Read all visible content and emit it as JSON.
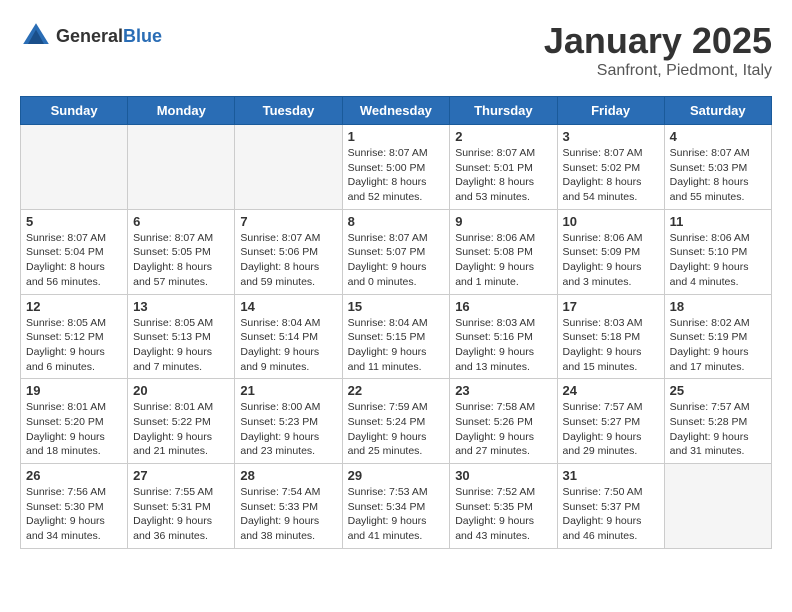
{
  "header": {
    "logo": {
      "text_general": "General",
      "text_blue": "Blue"
    },
    "title": "January 2025",
    "location": "Sanfront, Piedmont, Italy"
  },
  "weekdays": [
    "Sunday",
    "Monday",
    "Tuesday",
    "Wednesday",
    "Thursday",
    "Friday",
    "Saturday"
  ],
  "weeks": [
    [
      {
        "day": "",
        "info": ""
      },
      {
        "day": "",
        "info": ""
      },
      {
        "day": "",
        "info": ""
      },
      {
        "day": "1",
        "info": "Sunrise: 8:07 AM\nSunset: 5:00 PM\nDaylight: 8 hours\nand 52 minutes."
      },
      {
        "day": "2",
        "info": "Sunrise: 8:07 AM\nSunset: 5:01 PM\nDaylight: 8 hours\nand 53 minutes."
      },
      {
        "day": "3",
        "info": "Sunrise: 8:07 AM\nSunset: 5:02 PM\nDaylight: 8 hours\nand 54 minutes."
      },
      {
        "day": "4",
        "info": "Sunrise: 8:07 AM\nSunset: 5:03 PM\nDaylight: 8 hours\nand 55 minutes."
      }
    ],
    [
      {
        "day": "5",
        "info": "Sunrise: 8:07 AM\nSunset: 5:04 PM\nDaylight: 8 hours\nand 56 minutes."
      },
      {
        "day": "6",
        "info": "Sunrise: 8:07 AM\nSunset: 5:05 PM\nDaylight: 8 hours\nand 57 minutes."
      },
      {
        "day": "7",
        "info": "Sunrise: 8:07 AM\nSunset: 5:06 PM\nDaylight: 8 hours\nand 59 minutes."
      },
      {
        "day": "8",
        "info": "Sunrise: 8:07 AM\nSunset: 5:07 PM\nDaylight: 9 hours\nand 0 minutes."
      },
      {
        "day": "9",
        "info": "Sunrise: 8:06 AM\nSunset: 5:08 PM\nDaylight: 9 hours\nand 1 minute."
      },
      {
        "day": "10",
        "info": "Sunrise: 8:06 AM\nSunset: 5:09 PM\nDaylight: 9 hours\nand 3 minutes."
      },
      {
        "day": "11",
        "info": "Sunrise: 8:06 AM\nSunset: 5:10 PM\nDaylight: 9 hours\nand 4 minutes."
      }
    ],
    [
      {
        "day": "12",
        "info": "Sunrise: 8:05 AM\nSunset: 5:12 PM\nDaylight: 9 hours\nand 6 minutes."
      },
      {
        "day": "13",
        "info": "Sunrise: 8:05 AM\nSunset: 5:13 PM\nDaylight: 9 hours\nand 7 minutes."
      },
      {
        "day": "14",
        "info": "Sunrise: 8:04 AM\nSunset: 5:14 PM\nDaylight: 9 hours\nand 9 minutes."
      },
      {
        "day": "15",
        "info": "Sunrise: 8:04 AM\nSunset: 5:15 PM\nDaylight: 9 hours\nand 11 minutes."
      },
      {
        "day": "16",
        "info": "Sunrise: 8:03 AM\nSunset: 5:16 PM\nDaylight: 9 hours\nand 13 minutes."
      },
      {
        "day": "17",
        "info": "Sunrise: 8:03 AM\nSunset: 5:18 PM\nDaylight: 9 hours\nand 15 minutes."
      },
      {
        "day": "18",
        "info": "Sunrise: 8:02 AM\nSunset: 5:19 PM\nDaylight: 9 hours\nand 17 minutes."
      }
    ],
    [
      {
        "day": "19",
        "info": "Sunrise: 8:01 AM\nSunset: 5:20 PM\nDaylight: 9 hours\nand 18 minutes."
      },
      {
        "day": "20",
        "info": "Sunrise: 8:01 AM\nSunset: 5:22 PM\nDaylight: 9 hours\nand 21 minutes."
      },
      {
        "day": "21",
        "info": "Sunrise: 8:00 AM\nSunset: 5:23 PM\nDaylight: 9 hours\nand 23 minutes."
      },
      {
        "day": "22",
        "info": "Sunrise: 7:59 AM\nSunset: 5:24 PM\nDaylight: 9 hours\nand 25 minutes."
      },
      {
        "day": "23",
        "info": "Sunrise: 7:58 AM\nSunset: 5:26 PM\nDaylight: 9 hours\nand 27 minutes."
      },
      {
        "day": "24",
        "info": "Sunrise: 7:57 AM\nSunset: 5:27 PM\nDaylight: 9 hours\nand 29 minutes."
      },
      {
        "day": "25",
        "info": "Sunrise: 7:57 AM\nSunset: 5:28 PM\nDaylight: 9 hours\nand 31 minutes."
      }
    ],
    [
      {
        "day": "26",
        "info": "Sunrise: 7:56 AM\nSunset: 5:30 PM\nDaylight: 9 hours\nand 34 minutes."
      },
      {
        "day": "27",
        "info": "Sunrise: 7:55 AM\nSunset: 5:31 PM\nDaylight: 9 hours\nand 36 minutes."
      },
      {
        "day": "28",
        "info": "Sunrise: 7:54 AM\nSunset: 5:33 PM\nDaylight: 9 hours\nand 38 minutes."
      },
      {
        "day": "29",
        "info": "Sunrise: 7:53 AM\nSunset: 5:34 PM\nDaylight: 9 hours\nand 41 minutes."
      },
      {
        "day": "30",
        "info": "Sunrise: 7:52 AM\nSunset: 5:35 PM\nDaylight: 9 hours\nand 43 minutes."
      },
      {
        "day": "31",
        "info": "Sunrise: 7:50 AM\nSunset: 5:37 PM\nDaylight: 9 hours\nand 46 minutes."
      },
      {
        "day": "",
        "info": ""
      }
    ]
  ]
}
